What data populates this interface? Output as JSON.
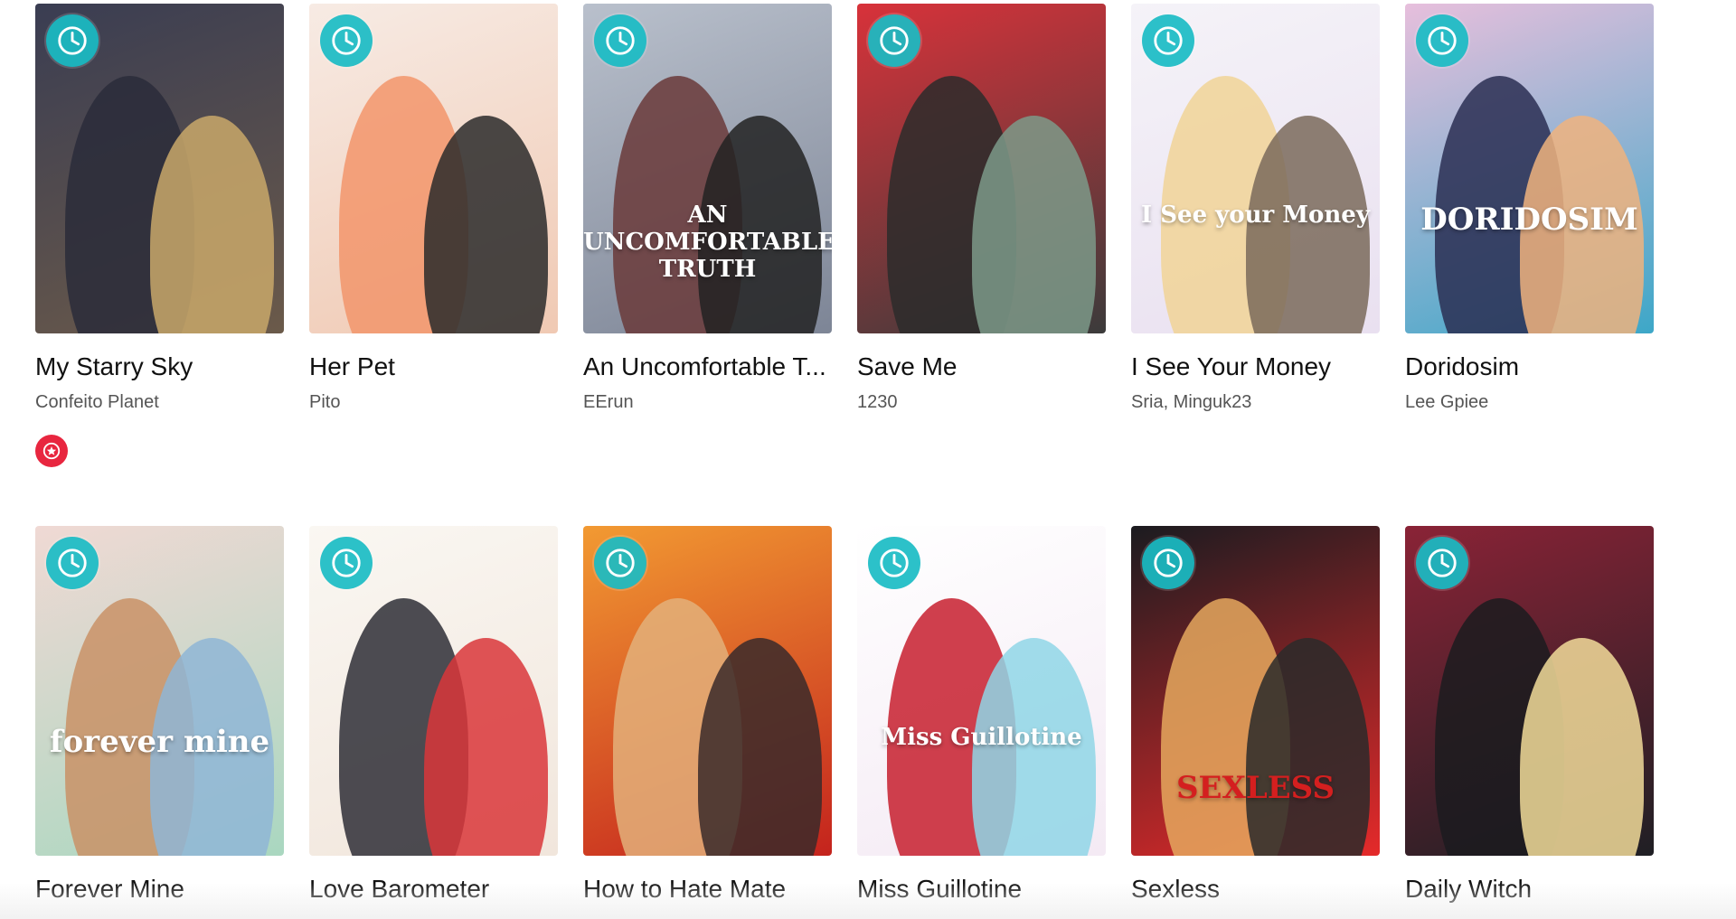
{
  "colors": {
    "wait_badge": "#1abcc4",
    "award_badge": "#e8263f",
    "title_text": "#111111",
    "author_text": "#555555"
  },
  "icons": {
    "wait_badge": "clock-icon",
    "award_badge": "star-award-icon"
  },
  "rows": [
    {
      "cards": [
        {
          "title": "My Starry Sky",
          "author": "Confeito Planet",
          "cover_art": "",
          "bg": [
            "#3a3d52",
            "#6b5a4a"
          ],
          "figs": [
            "#2a2b3a",
            "#c9a86a"
          ]
        },
        {
          "title": "Her Pet",
          "author": "Pito",
          "cover_art": "",
          "bg": [
            "#f7ebe4",
            "#f0c9b3"
          ],
          "figs": [
            "#f2956b",
            "#2a2a2a"
          ]
        },
        {
          "title": "An Uncomfortable T...",
          "author": "EErun",
          "cover_art": "AN UNCOMFORTABLE TRUTH",
          "bg": [
            "#b9c0cc",
            "#7d8596"
          ],
          "figs": [
            "#6a3a3a",
            "#222"
          ]
        },
        {
          "title": "Save Me",
          "author": "1230",
          "cover_art": "",
          "bg": [
            "#d8323a",
            "#3b3b3b"
          ],
          "figs": [
            "#2c2c2c",
            "#7c9a8a"
          ]
        },
        {
          "title": "I See Your Money",
          "author": "Sria, Minguk23",
          "cover_art": "I See your Money",
          "bg": [
            "#f5f3f8",
            "#e9e0f0"
          ],
          "figs": [
            "#f1d497",
            "#7a6a5a"
          ]
        },
        {
          "title": "Doridosim",
          "author": "Lee Gpiee",
          "cover_art": "DORIDOSIM",
          "bg": [
            "#e7bfdc",
            "#3da7c8"
          ],
          "figs": [
            "#2a2e52",
            "#f0b37e"
          ]
        }
      ],
      "award": true
    },
    {
      "cards": [
        {
          "title": "Forever Mine",
          "author": "",
          "cover_art": "forever mine",
          "bg": [
            "#f0d9d4",
            "#a9d7c0"
          ],
          "figs": [
            "#c99266",
            "#8fb6d6"
          ]
        },
        {
          "title": "Love Barometer",
          "author": "",
          "cover_art": "",
          "bg": [
            "#faf7f2",
            "#f1e6dc"
          ],
          "figs": [
            "#2e2e36",
            "#d9363a"
          ]
        },
        {
          "title": "How to Hate Mate",
          "author": "",
          "cover_art": "",
          "bg": [
            "#f29a32",
            "#c4231d"
          ],
          "figs": [
            "#e3b07a",
            "#3a2a2a"
          ]
        },
        {
          "title": "Miss Guillotine",
          "author": "",
          "cover_art": "Miss Guillotine",
          "bg": [
            "#ffffff",
            "#f4eaf4"
          ],
          "figs": [
            "#c71e2e",
            "#8fd6e6"
          ]
        },
        {
          "title": "Sexless",
          "author": "",
          "cover_art": "SEXLESS",
          "bg": [
            "#1b1b20",
            "#e52a2a"
          ],
          "figs": [
            "#e5a85e",
            "#2a2a2a"
          ]
        },
        {
          "title": "Daily Witch",
          "author": "",
          "cover_art": "",
          "bg": [
            "#8a2336",
            "#1f1f24"
          ],
          "figs": [
            "#1b1b1f",
            "#f2dc9a"
          ]
        }
      ],
      "award": false
    }
  ]
}
